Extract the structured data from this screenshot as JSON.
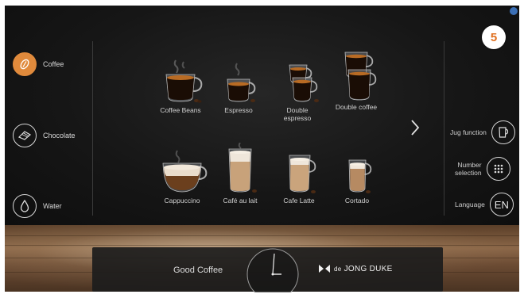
{
  "badge": "5",
  "sidebar": {
    "items": [
      {
        "label": "Coffee",
        "icon": "coffee-bean-icon",
        "active": true
      },
      {
        "label": "Chocolate",
        "icon": "chocolate-bar-icon",
        "active": false
      },
      {
        "label": "Water",
        "icon": "water-drop-icon",
        "active": false
      }
    ]
  },
  "drinks": [
    {
      "label": "Coffee Beans",
      "icon": "black-coffee-cup-icon"
    },
    {
      "label": "Espresso",
      "icon": "espresso-glass-icon"
    },
    {
      "label": "Double espresso",
      "icon": "double-espresso-glass-icon"
    },
    {
      "label": "Double coffee",
      "icon": "double-coffee-cup-icon"
    },
    {
      "label": "Cappuccino",
      "icon": "cappuccino-cup-icon"
    },
    {
      "label": "Café au lait",
      "icon": "cafe-au-lait-glass-icon"
    },
    {
      "label": "Cafe Latte",
      "icon": "latte-glass-icon"
    },
    {
      "label": "Cortado",
      "icon": "cortado-glass-icon"
    }
  ],
  "right_panel": {
    "jug_label": "Jug function",
    "number_label_line1": "Number",
    "number_label_line2": "selection",
    "language_label": "Language",
    "language_value": "EN"
  },
  "footer": {
    "slogan": "Good Coffee",
    "brand_small": "de",
    "brand_name": "JONG DUKE"
  },
  "colors": {
    "accent": "#e08a3c",
    "badge_text": "#e07020"
  }
}
